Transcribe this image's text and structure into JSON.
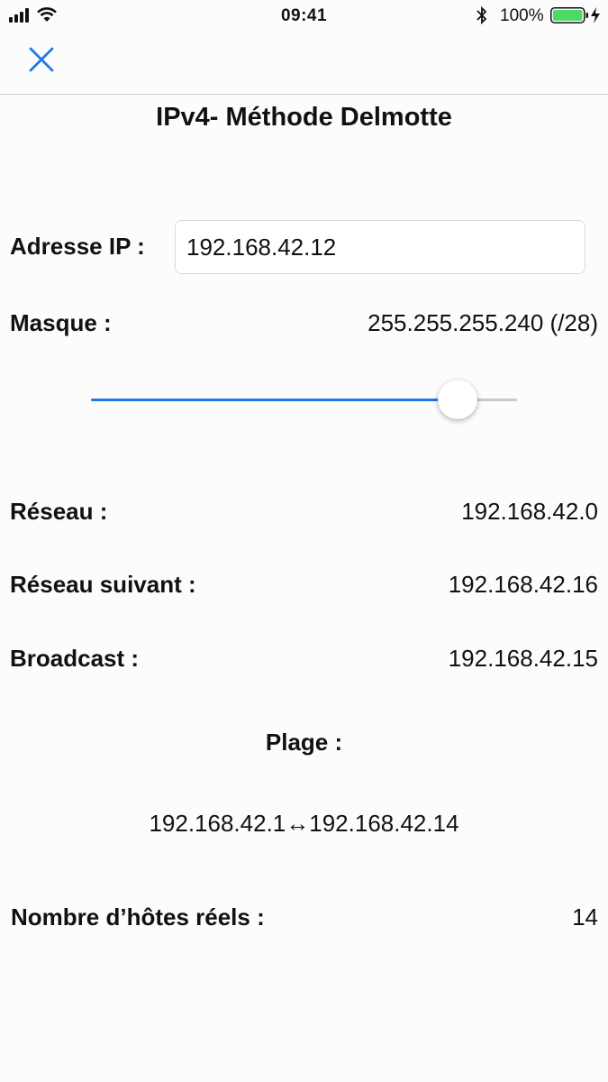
{
  "status_bar": {
    "time": "09:41",
    "battery_percent": "100%",
    "icons": [
      "signal-icon",
      "wifi-icon",
      "bluetooth-icon",
      "battery-icon",
      "charging-icon"
    ]
  },
  "nav": {
    "close_icon": "close-icon"
  },
  "title": "IPv4- Méthode Delmotte",
  "ip_address": {
    "label": "Adresse IP :",
    "value": "192.168.42.12"
  },
  "mask": {
    "label": "Masque :",
    "value": "255.255.255.240 (/28)"
  },
  "mask_slider": {
    "value_fraction": 0.86
  },
  "network": {
    "label": "Réseau :",
    "value": "192.168.42.0"
  },
  "next_network": {
    "label": "Réseau suivant :",
    "value": "192.168.42.16"
  },
  "broadcast": {
    "label": "Broadcast :",
    "value": "192.168.42.15"
  },
  "range": {
    "label": "Plage :",
    "value": "192.168.42.1↔192.168.42.14"
  },
  "hosts": {
    "label": "Nombre d’hôtes réels :",
    "value": "14"
  },
  "colors": {
    "accent": "#1e7ae6",
    "battery": "#4cd964"
  }
}
